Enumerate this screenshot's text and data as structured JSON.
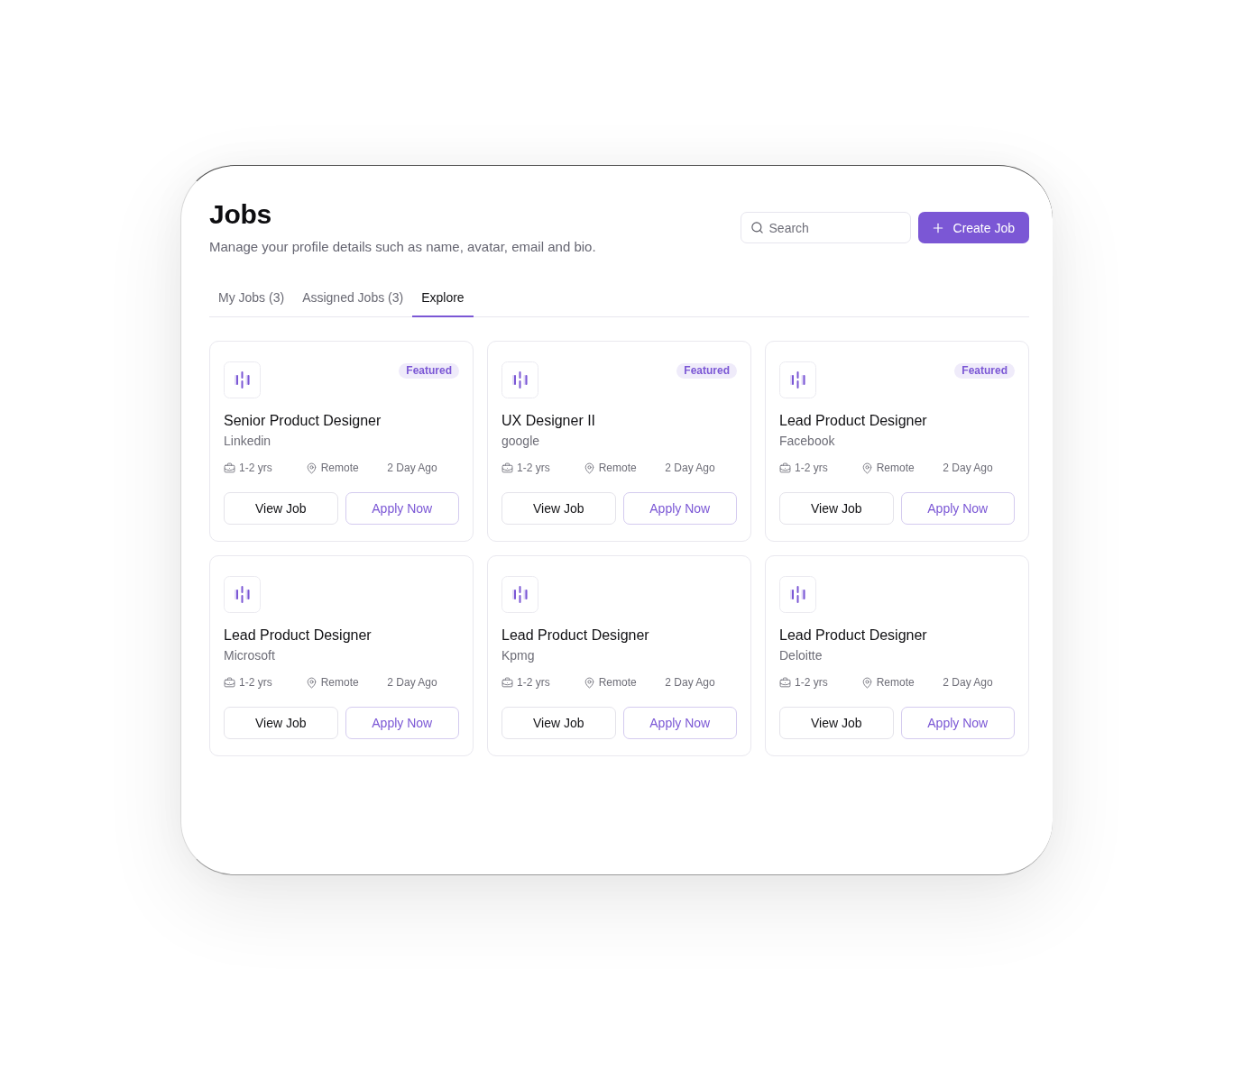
{
  "header": {
    "title": "Jobs",
    "subtitle": "Manage your profile details such as name, avatar, email and bio."
  },
  "search": {
    "placeholder": "Search"
  },
  "create_button": {
    "label": "Create Job"
  },
  "tabs": [
    {
      "label": "My Jobs (3)",
      "selected": false
    },
    {
      "label": "Assigned Jobs (3)",
      "selected": false
    },
    {
      "label": "Explore",
      "selected": true
    }
  ],
  "jobs": [
    {
      "title": "Senior Product Designer",
      "company": "Linkedin",
      "badge": "Featured",
      "experience": "1-2 yrs",
      "location": "Remote",
      "posted": "2 Day Ago",
      "view_label": "View Job",
      "apply_label": "Apply Now"
    },
    {
      "title": "UX Designer II",
      "company": "google",
      "badge": "Featured",
      "experience": "1-2 yrs",
      "location": "Remote",
      "posted": "2 Day Ago",
      "view_label": "View Job",
      "apply_label": "Apply Now"
    },
    {
      "title": "Lead Product Designer",
      "company": "Facebook",
      "badge": "Featured",
      "experience": "1-2 yrs",
      "location": "Remote",
      "posted": "2 Day Ago",
      "view_label": "View Job",
      "apply_label": "Apply Now"
    },
    {
      "title": "Lead Product Designer",
      "company": "Microsoft",
      "experience": "1-2 yrs",
      "location": "Remote",
      "posted": "2 Day Ago",
      "view_label": "View Job",
      "apply_label": "Apply Now"
    },
    {
      "title": "Lead Product Designer",
      "company": "Kpmg",
      "experience": "1-2 yrs",
      "location": "Remote",
      "posted": "2 Day Ago",
      "view_label": "View Job",
      "apply_label": "Apply Now"
    },
    {
      "title": "Lead Product Designer",
      "company": "Deloitte",
      "experience": "1-2 yrs",
      "location": "Remote",
      "posted": "2 Day Ago",
      "view_label": "View Job",
      "apply_label": "Apply Now"
    }
  ]
}
